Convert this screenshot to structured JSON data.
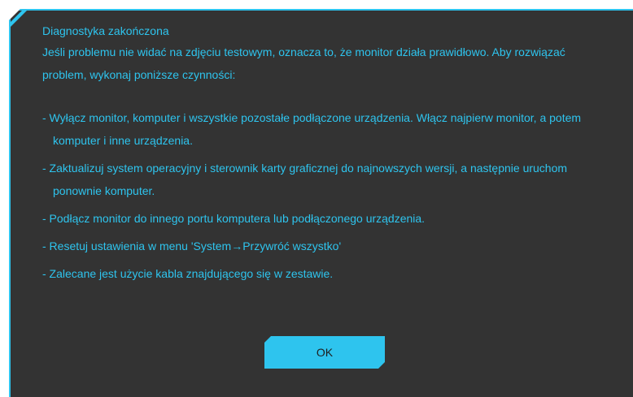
{
  "dialog": {
    "title": "Diagnostyka zakończona",
    "intro_line1": "Jeśli problemu nie widać na zdjęciu testowym, oznacza to, że monitor działa prawidłowo. Aby rozwiązać",
    "intro_line2": "problem, wykonaj poniższe czynności:",
    "steps": [
      "- Wyłącz monitor, komputer i wszystkie pozostałe podłączone urządzenia. Włącz najpierw monitor, a potem komputer i inne urządzenia.",
      "- Zaktualizuj system operacyjny i sterownik karty graficznej do najnowszych wersji, a następnie uruchom ponownie komputer.",
      "- Podłącz monitor do innego portu komputera lub podłączonego urządzenia.",
      "- Resetuj ustawienia w menu 'System→Przywróć wszystko'",
      "- Zalecane jest użycie kabla znajdującego się w zestawie."
    ],
    "ok_label": "OK"
  },
  "colors": {
    "accent": "#2ec4ee",
    "background": "#333333",
    "button_text": "#1f1f1f"
  }
}
